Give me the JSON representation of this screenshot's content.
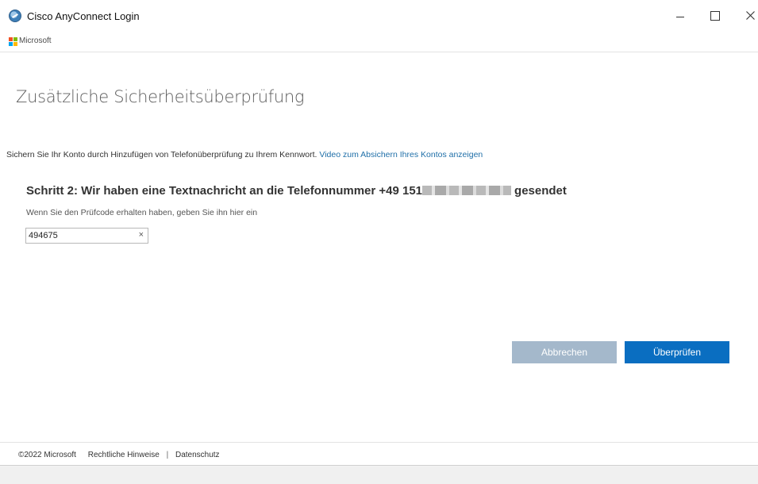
{
  "window": {
    "title": "Cisco AnyConnect Login",
    "controls": [
      "minimize",
      "maximize",
      "close"
    ]
  },
  "header": {
    "brand_label": "Microsoft"
  },
  "main": {
    "page_title": "Zusätzliche Sicherheitsüberprüfung",
    "intro_text": "Sichern Sie Ihr Konto durch Hinzufügen von Telefonüberprüfung zu Ihrem Kennwort.",
    "intro_link": "Video zum Absichern Ihres Kontos anzeigen",
    "step_heading_prefix": "Schritt 2: Wir haben eine Textnachricht an die Telefonnummer +49 151",
    "step_heading_suffix": "gesendet",
    "hint": "Wenn Sie den Prüfcode erhalten haben, geben Sie ihn hier ein",
    "code_value": "494675",
    "clear_glyph": "×",
    "cancel_label": "Abbrechen",
    "verify_label": "Überprüfen"
  },
  "footer": {
    "copyright": "©2022 Microsoft",
    "legal_link": "Rechtliche Hinweise",
    "separator": "|",
    "privacy_link": "Datenschutz"
  },
  "colors": {
    "primary_button": "#0a6ec1",
    "disabled_button": "#a4b8cb",
    "link": "#1f6fa8"
  }
}
